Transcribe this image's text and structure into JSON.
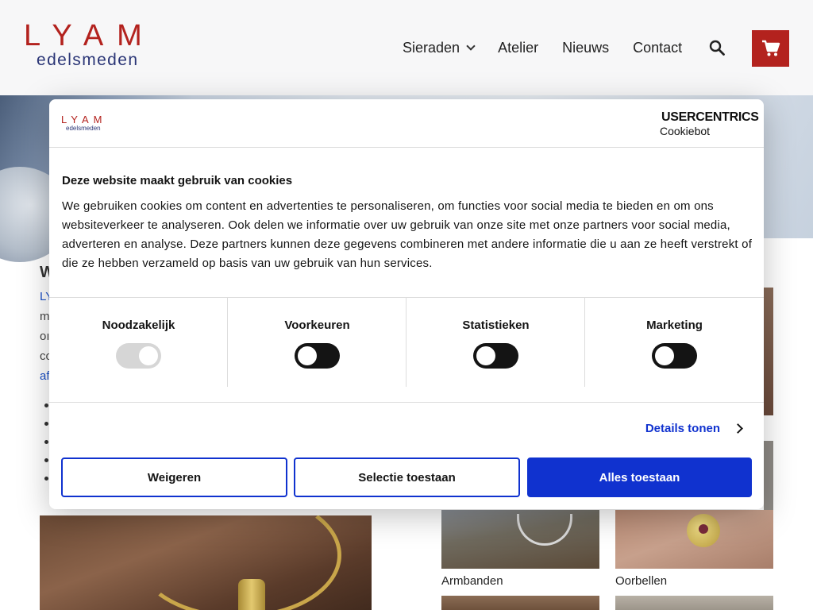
{
  "site": {
    "logo_top": "LYAM",
    "logo_bottom": "edelsmeden",
    "nav": [
      {
        "label": "Sieraden",
        "has_dropdown": true
      },
      {
        "label": "Atelier"
      },
      {
        "label": "Nieuws"
      },
      {
        "label": "Contact"
      }
    ],
    "icons": {
      "search": "search-icon",
      "cart": "cart-icon"
    },
    "accent_color": "#b3221e"
  },
  "background": {
    "heading_fragment": "W",
    "lines": [
      "LY",
      "m",
      "oı",
      "co",
      "af"
    ],
    "thumb_labels": [
      "Armbanden",
      "Oorbellen"
    ]
  },
  "dialog": {
    "brand_logo_top": "LYAM",
    "brand_logo_bottom": "edelsmeden",
    "provider_name": "USERCENTRICS",
    "provider_product": "Cookiebot",
    "title": "Deze website maakt gebruik van cookies",
    "body": "We gebruiken cookies om content en advertenties te personaliseren, om functies voor social media te bieden en om ons websiteverkeer te analyseren. Ook delen we informatie over uw gebruik van onze site met onze partners voor social media, adverteren en analyse. Deze partners kunnen deze gegevens combineren met andere informatie die u aan ze heeft verstrekt of die ze hebben verzameld op basis van uw gebruik van hun services.",
    "categories": [
      {
        "label": "Noodzakelijk",
        "enabled": true,
        "locked": true
      },
      {
        "label": "Voorkeuren",
        "enabled": false
      },
      {
        "label": "Statistieken",
        "enabled": false
      },
      {
        "label": "Marketing",
        "enabled": false
      }
    ],
    "details_label": "Details tonen",
    "buttons": {
      "deny": "Weigeren",
      "allow_selection": "Selectie toestaan",
      "allow_all": "Alles toestaan"
    },
    "primary_color": "#1032cf"
  }
}
